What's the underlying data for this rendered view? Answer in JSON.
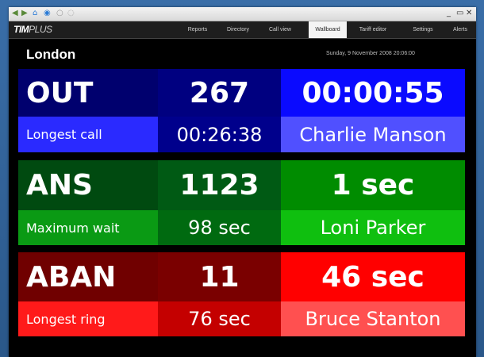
{
  "window": {
    "toolbar_icons": [
      "back-icon",
      "forward-icon",
      "home-icon",
      "browser-icon",
      "stop-icon",
      "refresh-icon"
    ],
    "controls": [
      "_",
      "▭",
      "✕"
    ]
  },
  "brand": {
    "logo_main": "TIM",
    "logo_plus": "PLUS"
  },
  "nav": [
    "Reports",
    "Directory",
    "Call view",
    "Wallboard",
    "Tariff editor",
    "Settings",
    "Alerts"
  ],
  "active_nav": "Wallboard",
  "location": "London",
  "datetime": "Sunday, 9 November 2008 20:06:00",
  "panels": [
    {
      "code": "OUT",
      "count": "267",
      "stat": "00:00:55",
      "sub_label": "Longest call",
      "sub_value": "00:26:38",
      "sub_person": "Charlie Manson",
      "colors": {
        "a": "#00006e",
        "b": "#000080",
        "c": "#0a0aff",
        "d": "#2a2aff",
        "e": "#00008c",
        "f": "#5050ff"
      }
    },
    {
      "code": "ANS",
      "count": "1123",
      "stat": "1 sec",
      "sub_label": "Maximum wait",
      "sub_value": "98 sec",
      "sub_person": "Loni Parker",
      "colors": {
        "a": "#004a10",
        "b": "#005a14",
        "c": "#008c00",
        "d": "#0a9a14",
        "e": "#006a10",
        "f": "#0fbf0f"
      }
    },
    {
      "code": "ABAN",
      "count": "11",
      "stat": "46 sec",
      "sub_label": "Longest ring",
      "sub_value": "76 sec",
      "sub_person": "Bruce Stanton",
      "colors": {
        "a": "#700000",
        "b": "#7a0000",
        "c": "#ff0000",
        "d": "#ff1a1a",
        "e": "#c40000",
        "f": "#ff5050"
      }
    }
  ]
}
